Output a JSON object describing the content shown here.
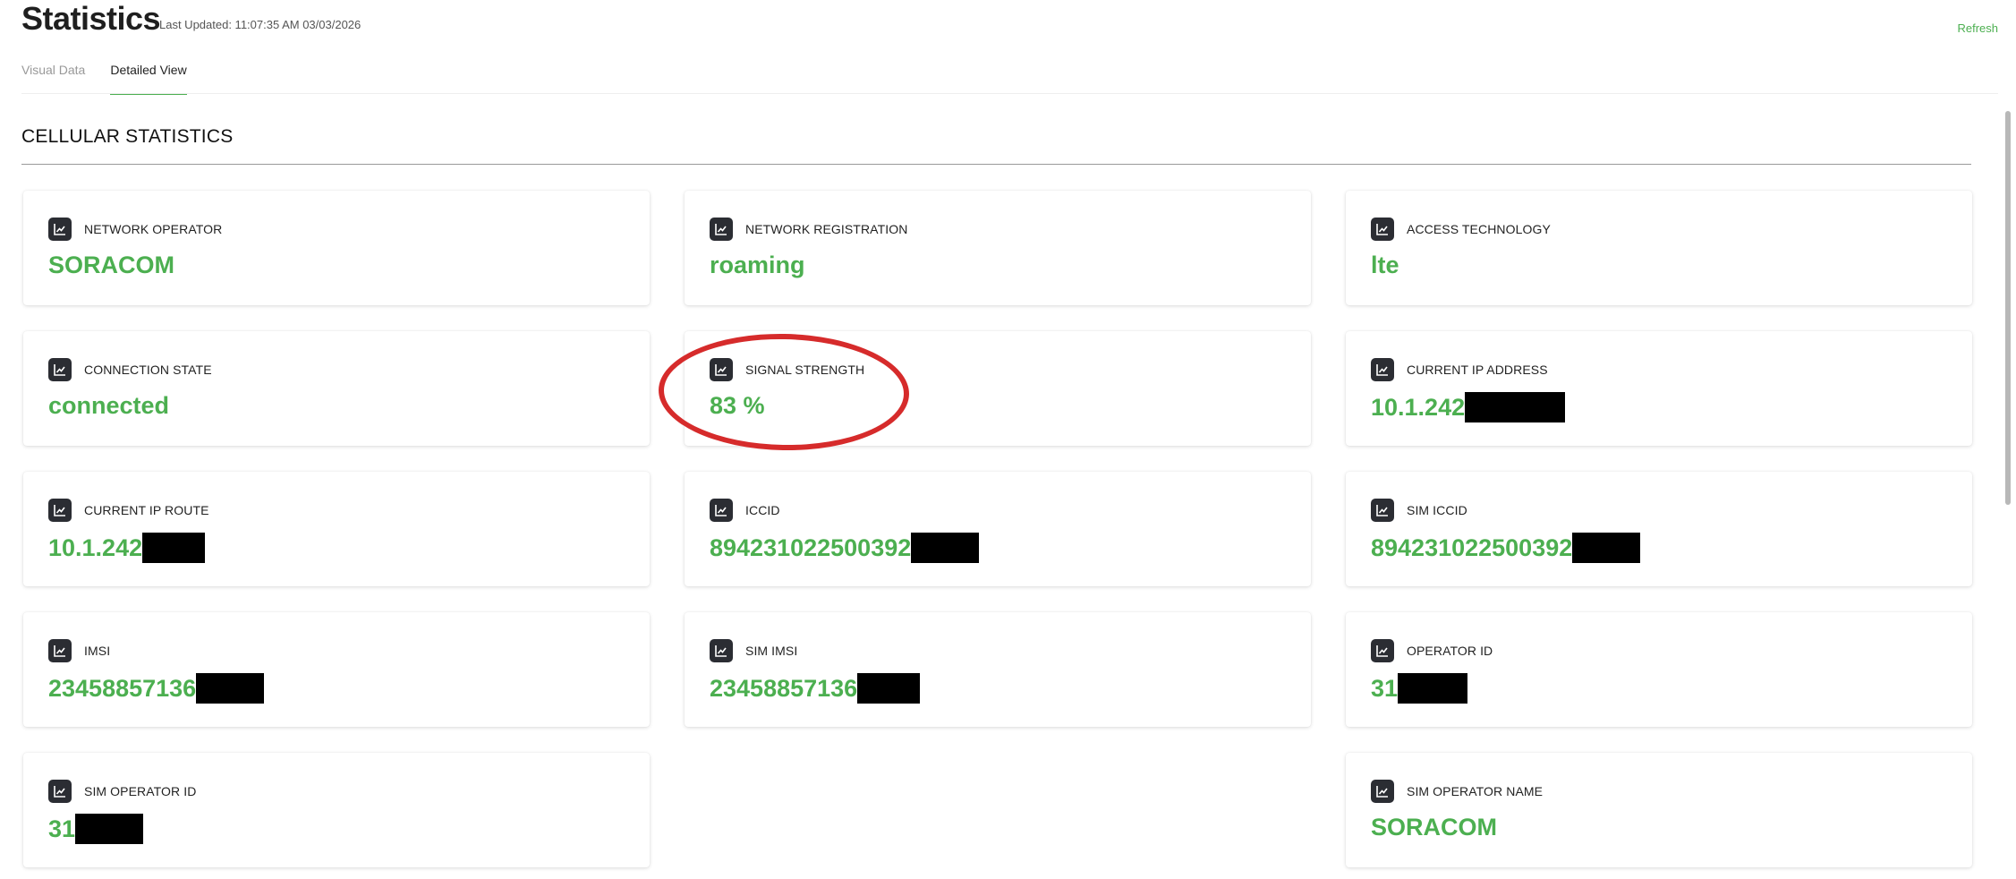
{
  "header": {
    "title": "Statistics",
    "last_updated": "Last Updated: 11:07:35 AM 03/03/2026",
    "refresh_label": "Refresh"
  },
  "tabs": [
    {
      "label": "Visual Data",
      "active": false
    },
    {
      "label": "Detailed View",
      "active": true
    }
  ],
  "section": {
    "title": "CELLULAR STATISTICS"
  },
  "colors": {
    "accent": "#4caf50",
    "annotation": "#d62b2b",
    "icon_bg": "#2b2d33"
  },
  "icon": "line-chart-icon",
  "cards": [
    {
      "label": "NETWORK OPERATOR",
      "value": "SORACOM"
    },
    {
      "label": "NETWORK REGISTRATION",
      "value": "roaming"
    },
    {
      "label": "ACCESS TECHNOLOGY",
      "value": "lte"
    },
    {
      "label": "CONNECTION STATE",
      "value": "connected"
    },
    {
      "label": "SIGNAL STRENGTH",
      "value": "83 %"
    },
    {
      "label": "CURRENT IP ADDRESS",
      "value": "10.1.242"
    },
    {
      "label": "CURRENT IP ROUTE",
      "value": "10.1.242"
    },
    {
      "label": "ICCID",
      "value": "894231022500392"
    },
    {
      "label": "SIM ICCID",
      "value": "894231022500392"
    },
    {
      "label": "IMSI",
      "value": "23458857136"
    },
    {
      "label": "SIM IMSI",
      "value": "23458857136"
    },
    {
      "label": "OPERATOR ID",
      "value": "31"
    },
    {
      "label": "SIM OPERATOR ID",
      "value": "31"
    },
    {
      "label": "SIM OPERATOR NAME",
      "value": "SORACOM"
    }
  ]
}
